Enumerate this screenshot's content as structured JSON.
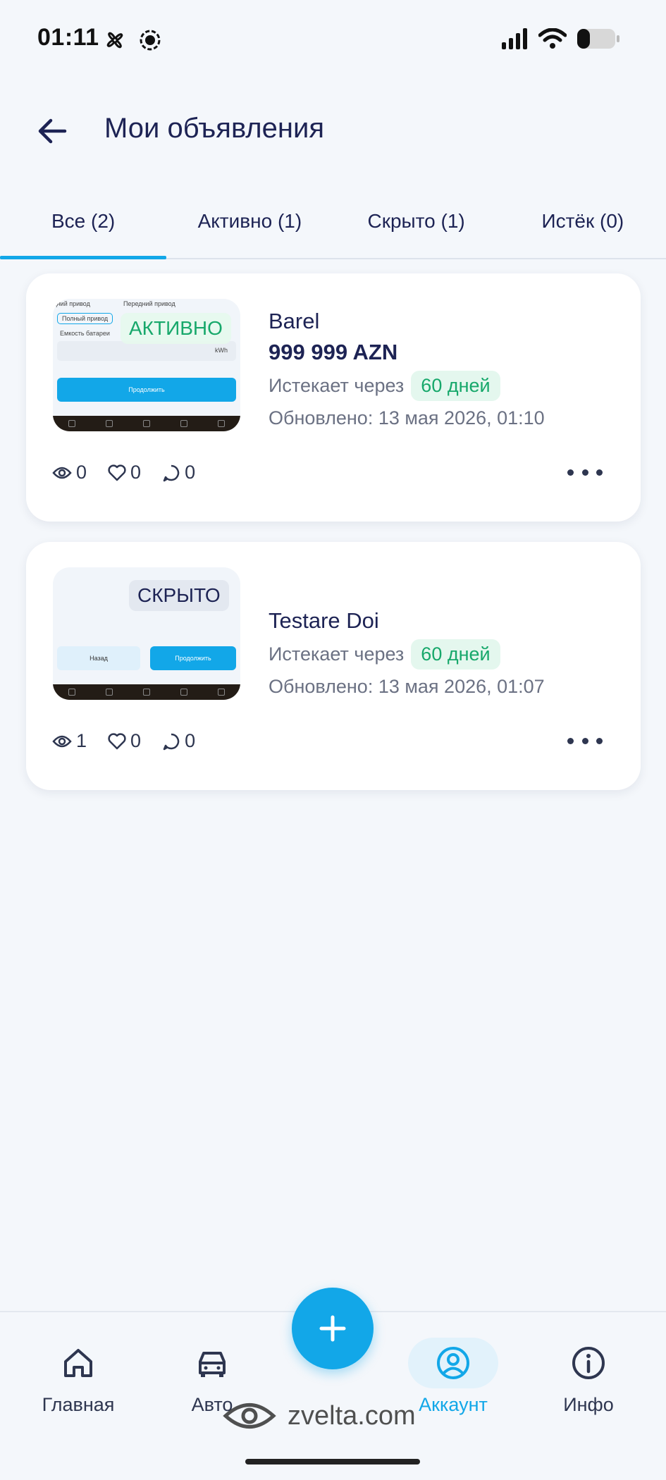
{
  "status_bar": {
    "time": "01:11"
  },
  "header": {
    "title": "Мои объявления"
  },
  "tabs": [
    {
      "label": "Все (2)",
      "active": true
    },
    {
      "label": "Активно (1)",
      "active": false
    },
    {
      "label": "Скрыто (1)",
      "active": false
    },
    {
      "label": "Истёк (0)",
      "active": false
    }
  ],
  "listings": [
    {
      "status": "АКТИВНО",
      "title": "Barel",
      "price": "999 999 AZN",
      "expires_label": "Истекает через",
      "expires_value": "60 дней",
      "updated": "Обновлено: 13 мая 2026, 01:10",
      "views": "0",
      "likes": "0",
      "comments": "0",
      "thumb": {
        "tab1": "Задний привод",
        "tab2": "Передний привод",
        "chip": "Полный привод",
        "field_label": "Емкость батареи",
        "field_unit": "kWh",
        "button": "Продолжить"
      }
    },
    {
      "status": "СКРЫТО",
      "title": "Testare Doi",
      "expires_label": "Истекает через",
      "expires_value": "60 дней",
      "updated": "Обновлено: 13 мая 2026, 01:07",
      "views": "1",
      "likes": "0",
      "comments": "0",
      "thumb": {
        "back": "Назад",
        "button": "Продолжить"
      }
    }
  ],
  "bottom_nav": [
    {
      "label": "Главная",
      "icon": "home-icon"
    },
    {
      "label": "Авто",
      "icon": "car-icon"
    },
    {
      "label": "Аккаунт",
      "icon": "account-icon",
      "active": true
    },
    {
      "label": "Инфо",
      "icon": "info-icon"
    }
  ],
  "watermark": "zvelta.com",
  "colors": {
    "accent": "#12a7e8",
    "active_badge": "#17a86b",
    "text": "#1d2354"
  }
}
